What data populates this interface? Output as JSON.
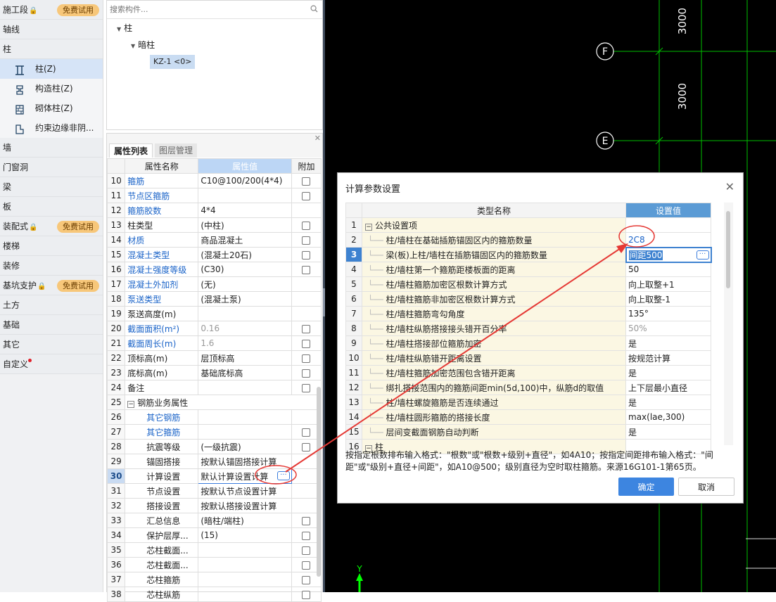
{
  "sidebar": {
    "badge_label": "免费试用",
    "categories_top": [
      {
        "label": "施工段",
        "badge": true,
        "locked": true
      },
      {
        "label": "轴线"
      },
      {
        "label": "柱"
      }
    ],
    "column_items": [
      {
        "label": "柱(Z)",
        "icon": "column-icon",
        "selected": true
      },
      {
        "label": "构造柱(Z)",
        "icon": "construction-column-icon"
      },
      {
        "label": "砌体柱(Z)",
        "icon": "masonry-column-icon"
      },
      {
        "label": "约束边缘非阴...",
        "icon": "boundary-column-icon"
      }
    ],
    "categories_bottom": [
      {
        "label": "墙"
      },
      {
        "label": "门窗洞"
      },
      {
        "label": "梁"
      },
      {
        "label": "板"
      },
      {
        "label": "装配式",
        "badge": true,
        "locked": true
      },
      {
        "label": "楼梯"
      },
      {
        "label": "装修"
      },
      {
        "label": "基坑支护",
        "badge": true,
        "locked": true
      },
      {
        "label": "土方"
      },
      {
        "label": "基础"
      },
      {
        "label": "其它"
      },
      {
        "label": "自定义",
        "dot": true
      }
    ]
  },
  "tree": {
    "search_placeholder": "搜索构件...",
    "root": "柱",
    "child": "暗柱",
    "item": "KZ-1 <0>"
  },
  "properties": {
    "tabs": [
      "属性列表",
      "图层管理"
    ],
    "headers": [
      "属性名称",
      "属性值",
      "附加"
    ],
    "rows": [
      {
        "n": "10",
        "name": "箍筋",
        "value": "C10@100/200(4*4)",
        "blue": true,
        "cb": true
      },
      {
        "n": "11",
        "name": "节点区箍筋",
        "value": "",
        "blue": true,
        "cb": true
      },
      {
        "n": "12",
        "name": "箍筋胶数",
        "value": "4*4",
        "blue": true,
        "cb": false
      },
      {
        "n": "13",
        "name": "柱类型",
        "value": "(中柱)",
        "cb": true
      },
      {
        "n": "14",
        "name": "材质",
        "value": "商品混凝土",
        "blue": true,
        "cb": true
      },
      {
        "n": "15",
        "name": "混凝土类型",
        "value": "(混凝土20石)",
        "blue": true,
        "cb": true
      },
      {
        "n": "16",
        "name": "混凝土强度等级",
        "value": "(C30)",
        "blue": true,
        "cb": true
      },
      {
        "n": "17",
        "name": "混凝土外加剂",
        "value": "(无)",
        "blue": true,
        "cb": false
      },
      {
        "n": "18",
        "name": "泵送类型",
        "value": "(混凝土泵)",
        "blue": true,
        "cb": false
      },
      {
        "n": "19",
        "name": "泵送高度(m)",
        "value": "",
        "cb": false
      },
      {
        "n": "20",
        "name": "截面面积(m²)",
        "value": "0.16",
        "blue": true,
        "gray": true,
        "cb": true
      },
      {
        "n": "21",
        "name": "截面周长(m)",
        "value": "1.6",
        "blue": true,
        "gray": true,
        "cb": true
      },
      {
        "n": "22",
        "name": "顶标高(m)",
        "value": "层顶标高",
        "cb": true
      },
      {
        "n": "23",
        "name": "底标高(m)",
        "value": "基础底标高",
        "cb": true
      },
      {
        "n": "24",
        "name": "备注",
        "value": "",
        "cb": true
      },
      {
        "n": "25",
        "name": "钢筋业务属性",
        "value": "",
        "group": true
      },
      {
        "n": "26",
        "name": "其它钢筋",
        "value": "",
        "blue": true,
        "indent": true,
        "cb": false
      },
      {
        "n": "27",
        "name": "其它箍筋",
        "value": "",
        "blue": true,
        "indent": true,
        "cb": true
      },
      {
        "n": "28",
        "name": "抗震等级",
        "value": "(一级抗震)",
        "indent": true,
        "cb": true
      },
      {
        "n": "29",
        "name": "锚固搭接",
        "value": "按默认锚固搭接计算",
        "indent": true,
        "cb": false
      },
      {
        "n": "30",
        "name": "计算设置",
        "value": "默认计算设置计算",
        "indent": true,
        "cb": false,
        "selected": true
      },
      {
        "n": "31",
        "name": "节点设置",
        "value": "按默认节点设置计算",
        "indent": true,
        "cb": false
      },
      {
        "n": "32",
        "name": "搭接设置",
        "value": "按默认搭接设置计算",
        "indent": true,
        "cb": false
      },
      {
        "n": "33",
        "name": "汇总信息",
        "value": "(暗柱/端柱)",
        "indent": true,
        "cb": true
      },
      {
        "n": "34",
        "name": "保护层厚...",
        "value": "(15)",
        "indent": true,
        "cb": true
      },
      {
        "n": "35",
        "name": "芯柱截面...",
        "value": "",
        "indent": true,
        "cb": true
      },
      {
        "n": "36",
        "name": "芯柱截面...",
        "value": "",
        "indent": true,
        "cb": true
      },
      {
        "n": "37",
        "name": "芯柱箍筋",
        "value": "",
        "indent": true,
        "cb": true
      },
      {
        "n": "38",
        "name": "芯柱纵筋",
        "value": "",
        "indent": true,
        "cb": true
      }
    ]
  },
  "cad": {
    "axis_labels": [
      "F",
      "E"
    ],
    "dimensions": [
      "3000",
      "3000"
    ],
    "y_axis": "Y"
  },
  "dialog": {
    "title": "计算参数设置",
    "headers": [
      "类型名称",
      "设置值"
    ],
    "rows": [
      {
        "n": "1",
        "name": "公共设置项",
        "value": "",
        "group": true
      },
      {
        "n": "2",
        "name": "柱/墙柱在基础插筋锚固区内的箍筋数量",
        "value": "2C8",
        "blue": true
      },
      {
        "n": "3",
        "name": "梁(板)上柱/墙柱在插筋锚固区内的箍筋数量",
        "value": "间距500",
        "selected": true
      },
      {
        "n": "4",
        "name": "柱/墙柱第一个箍筋距楼板面的距离",
        "value": "50"
      },
      {
        "n": "5",
        "name": "柱/墙柱箍筋加密区根数计算方式",
        "value": "向上取整+1"
      },
      {
        "n": "6",
        "name": "柱/墙柱箍筋非加密区根数计算方式",
        "value": "向上取整-1"
      },
      {
        "n": "7",
        "name": "柱/墙柱箍筋弯勾角度",
        "value": "135°"
      },
      {
        "n": "8",
        "name": "柱/墙柱纵筋搭接接头错开百分率",
        "value": "50%",
        "gray": true
      },
      {
        "n": "9",
        "name": "柱/墙柱搭接部位箍筋加密",
        "value": "是"
      },
      {
        "n": "10",
        "name": "柱/墙柱纵筋错开距离设置",
        "value": "按规范计算"
      },
      {
        "n": "11",
        "name": "柱/墙柱箍筋加密范围包含错开距离",
        "value": "是"
      },
      {
        "n": "12",
        "name": "绑扎搭接范围内的箍筋间距min(5d,100)中，纵筋d的取值",
        "value": "上下层最小直径"
      },
      {
        "n": "13",
        "name": "柱/墙柱螺旋箍筋是否连续通过",
        "value": "是"
      },
      {
        "n": "14",
        "name": "柱/墙柱圆形箍筋的搭接长度",
        "value": "max(lae,300)"
      },
      {
        "n": "15",
        "name": "层间变截面钢筋自动判断",
        "value": "是"
      },
      {
        "n": "16",
        "name": "柱",
        "value": "",
        "group": true
      }
    ],
    "hint": "按指定根数排布输入格式：\"根数\"或\"根数+级别+直径\"，如4A10；按指定间距排布输入格式：\"间距\"或\"级别+直径+间距\"，如A10@500；级别直径为空时取柱箍筋。来源16G101-1第65页。",
    "ok_label": "确定",
    "cancel_label": "取消"
  },
  "colors": {
    "accent": "#3d85e0",
    "badge": "#f7c77a",
    "annotation": "#e53935",
    "cad_green": "#00c000"
  }
}
